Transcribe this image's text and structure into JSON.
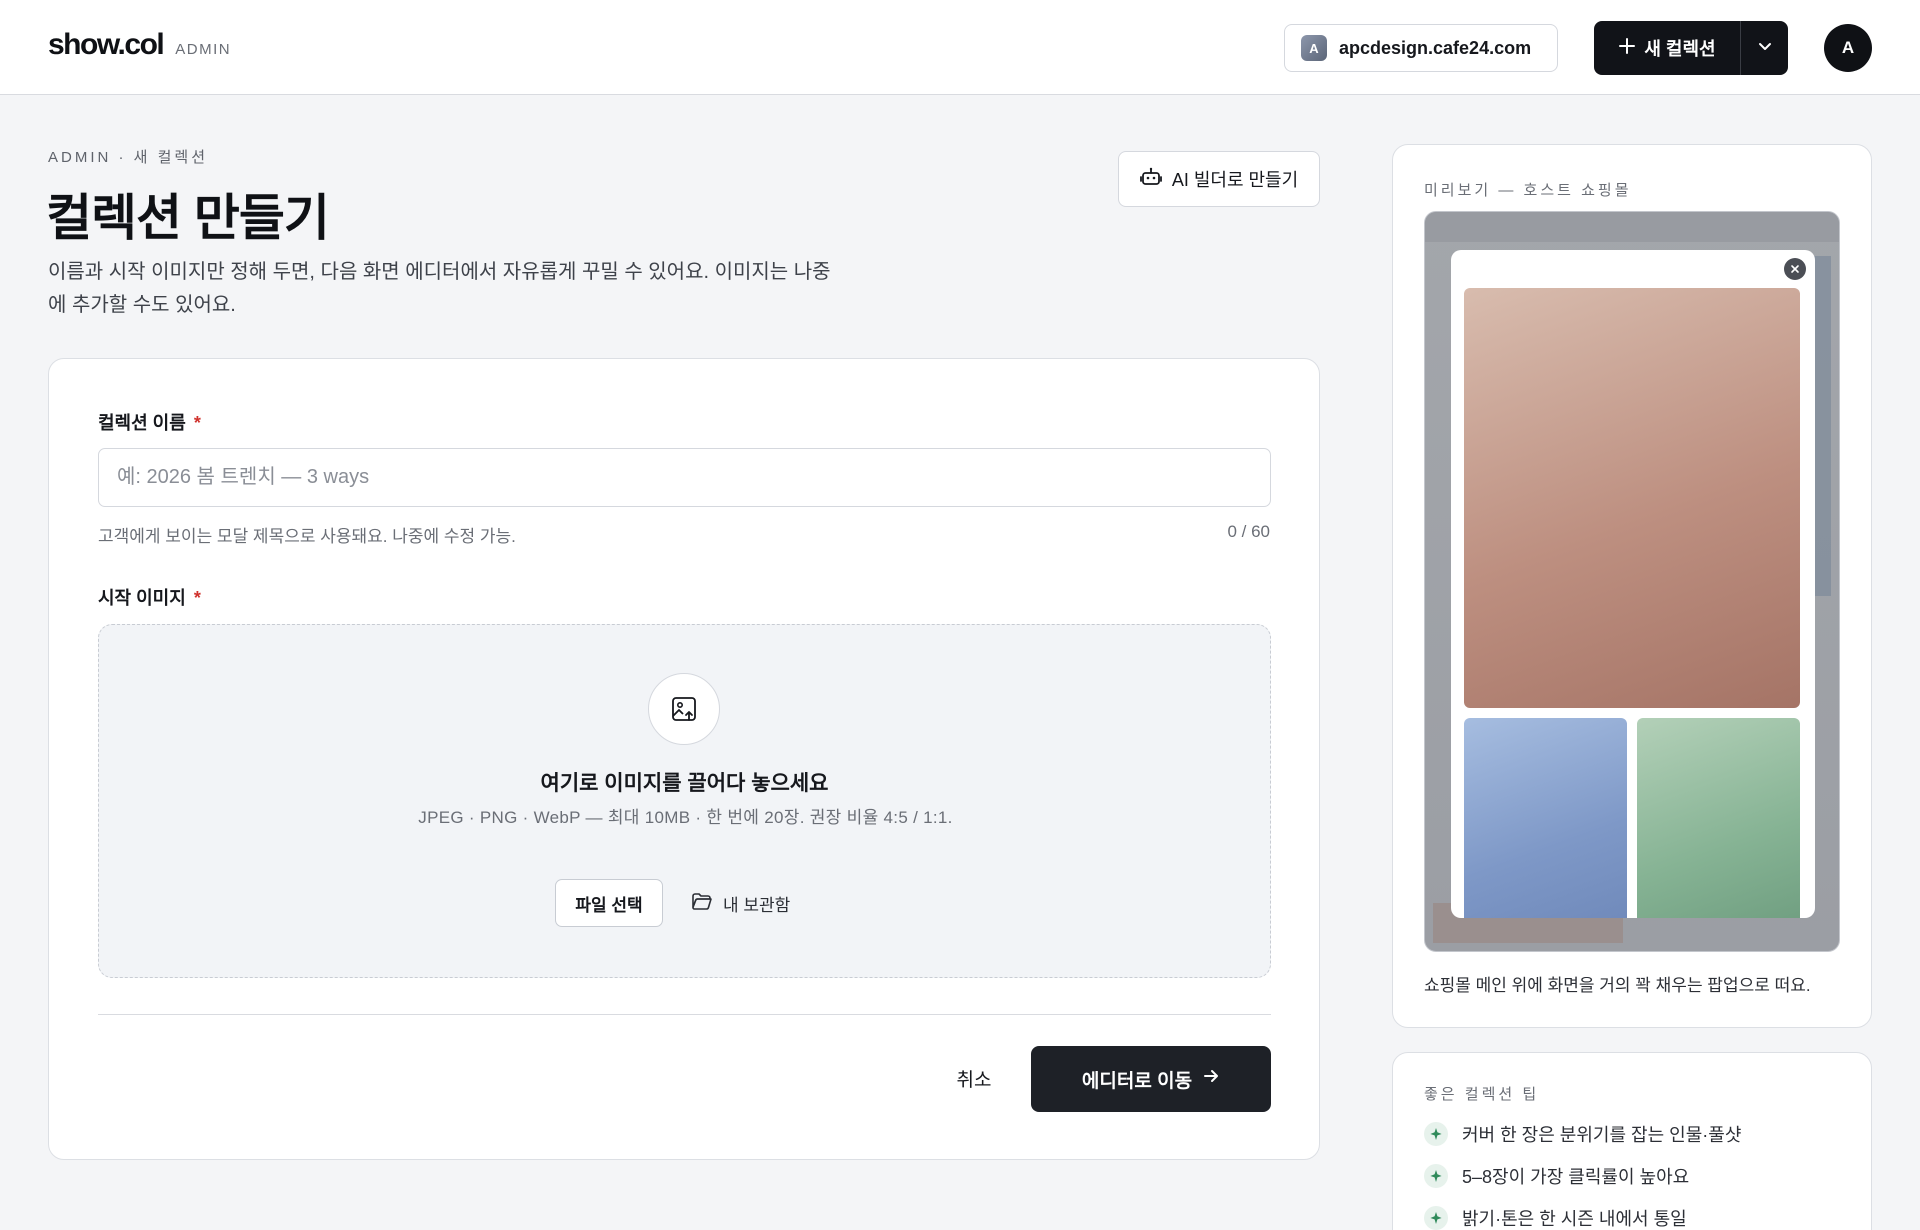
{
  "header": {
    "logo": "show.col",
    "badge": "ADMIN",
    "domain_initial": "A",
    "domain": "apcdesign.cafe24.com",
    "new_button": "새 컬렉션",
    "user_initial": "A"
  },
  "page": {
    "breadcrumb": "ADMIN · 새 컬렉션",
    "title": "컬렉션 만들기",
    "description": "이름과 시작 이미지만 정해 두면, 다음 화면 에디터에서 자유롭게 꾸밀 수 있어요. 이미지는 나중에 추가할 수도 있어요.",
    "ai_button": "AI 빌더로 만들기"
  },
  "form": {
    "name_label": "컬렉션 이름",
    "required_mark": "*",
    "name_value": "",
    "name_placeholder": "예: 2026 봄 트렌치 — 3 ways",
    "name_hint": "고객에게 보이는 모달 제목으로 사용돼요. 나중에 수정 가능.",
    "name_counter": "0 / 60",
    "image_label": "시작 이미지",
    "dropzone_title": "여기로 이미지를 끌어다 놓으세요",
    "dropzone_sub": "JPEG · PNG · WebP — 최대 10MB · 한 번에 20장. 권장 비율 4:5 / 1:1.",
    "file_button": "파일 선택",
    "library_button": "내 보관함",
    "cancel_button": "취소",
    "submit_button": "에디터로 이동"
  },
  "preview": {
    "label": "미리보기 — 호스트 쇼핑몰",
    "caption": "쇼핑몰 메인 위에 화면을 거의 꽉 채우는 팝업으로 떠요."
  },
  "tips": {
    "label": "좋은 컬렉션 팁",
    "items": [
      "커버 한 장은 분위기를 잡는 인물·풀샷",
      "5–8장이 가장 클릭률이 높아요",
      "밝기·톤은 한 시즌 내에서 통일"
    ]
  },
  "colors": {
    "primary": "#111318",
    "required": "#d0322d",
    "tip_accent": "#2f8a5a"
  }
}
